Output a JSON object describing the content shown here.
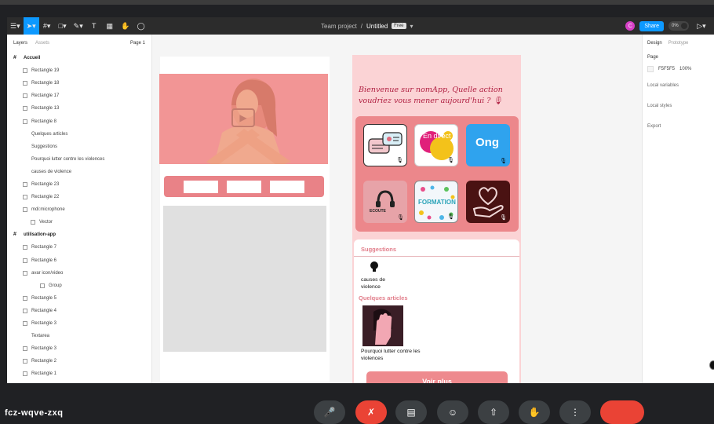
{
  "toolbar": {
    "team": "Team project",
    "separator": "/",
    "file": "Untitled",
    "badge": "Free",
    "avatar": "C",
    "share": "Share",
    "toggle": "0%"
  },
  "layers_panel": {
    "tab_layers": "Layers",
    "tab_assets": "Assets",
    "page": "Page 1",
    "items": [
      {
        "label": "Accueil",
        "type": "frame"
      },
      {
        "label": "Rectangle 19",
        "type": "rect"
      },
      {
        "label": "Rectangle 18",
        "type": "rect"
      },
      {
        "label": "Rectangle 17",
        "type": "rect"
      },
      {
        "label": "Rectangle 13",
        "type": "rect"
      },
      {
        "label": "Rectangle 8",
        "type": "rect"
      },
      {
        "label": "Quelques articles",
        "type": "text"
      },
      {
        "label": "Suggestions",
        "type": "text"
      },
      {
        "label": "Pourquoi lutter contre les violences",
        "type": "text"
      },
      {
        "label": "causes de violence",
        "type": "text"
      },
      {
        "label": "Rectangle 23",
        "type": "rect"
      },
      {
        "label": "Rectangle 22",
        "type": "rect"
      },
      {
        "label": "mdi:microphone",
        "type": "group"
      },
      {
        "label": "Vector",
        "type": "vector"
      },
      {
        "label": "utilisation-app",
        "type": "frame"
      },
      {
        "label": "Rectangle 7",
        "type": "rect"
      },
      {
        "label": "Rectangle 6",
        "type": "rect"
      },
      {
        "label": "avar icon/video",
        "type": "group"
      },
      {
        "label": "Group",
        "type": "group"
      },
      {
        "label": "Rectangle 5",
        "type": "rect"
      },
      {
        "label": "Rectangle 4",
        "type": "rect"
      },
      {
        "label": "Rectangle 3",
        "type": "rect"
      },
      {
        "label": "Textarea",
        "type": "text"
      },
      {
        "label": "Rectangle 3",
        "type": "rect"
      },
      {
        "label": "Rectangle 2",
        "type": "rect"
      },
      {
        "label": "Rectangle 1",
        "type": "rect"
      }
    ]
  },
  "props_panel": {
    "tab_design": "Design",
    "tab_prototype": "Prototype",
    "page_label": "Page",
    "page_color": "F5F5F5",
    "page_opacity": "100%",
    "local_variables": "Local variables",
    "local_styles": "Local styles",
    "export": "Export"
  },
  "phone": {
    "welcome": "Bienvenue sur nomApp, Quelle action voudriez vous mener aujourd'hui ? 🎙",
    "tiles": [
      {
        "name": "chat",
        "text": ""
      },
      {
        "name": "en-direct",
        "text": "En direct"
      },
      {
        "name": "ong",
        "text": "Ong"
      },
      {
        "name": "ecoute",
        "text": "ECOUTE"
      },
      {
        "name": "formation",
        "text": "FORMATION"
      },
      {
        "name": "aide",
        "text": "Aide"
      }
    ],
    "suggestions": "Suggestions",
    "causes": "causes de violence",
    "articles": "Quelques articles",
    "pourquoi": "Pourquoi lutter contre les violences",
    "voir_plus": "Voir plus"
  },
  "meeting": {
    "code": "fcz-wqve-zxq"
  },
  "colors": {
    "accent": "#0d99ff",
    "pink": "#ec878b",
    "phone_bg": "#fbd3d5"
  }
}
